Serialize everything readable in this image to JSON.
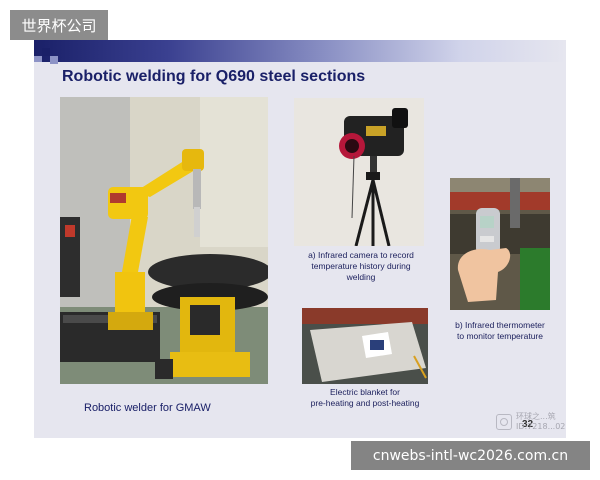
{
  "slide": {
    "title": "Robotic welding for Q690 steel sections",
    "page_number": "32"
  },
  "photos": {
    "robot": {
      "caption": "Robotic welder for GMAW"
    },
    "infrared_camera": {
      "caption_lines": [
        "a)  Infrared camera to record",
        "temperature history during",
        "welding"
      ]
    },
    "thermometer": {
      "caption_lines": [
        "b)  Infrared thermometer",
        "to monitor temperature"
      ]
    },
    "blanket": {
      "caption_lines": [
        "Electric blanket for",
        "pre-heating and post-heating"
      ]
    }
  },
  "watermarks": {
    "top_left": "世界杯公司",
    "bottom_right": "cnwebs-intl-wc2026.com.cn",
    "slide_corner_lines": [
      "环球之...筑",
      "ID:7218...02"
    ]
  },
  "icons": {
    "watermark_logo": "camera-logo-icon"
  }
}
